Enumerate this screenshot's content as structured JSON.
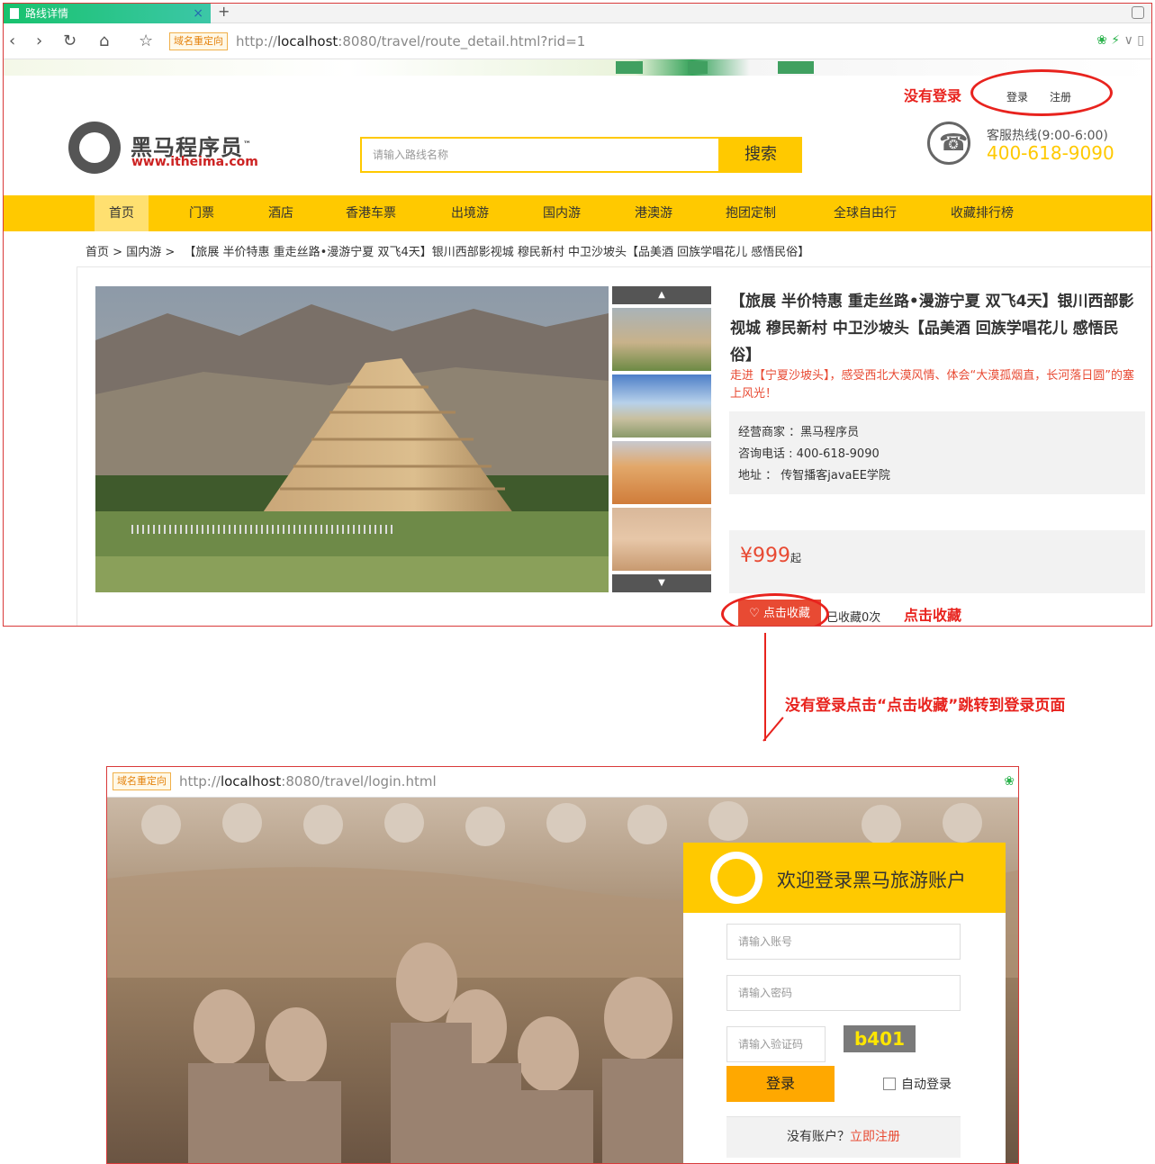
{
  "top_browser": {
    "tab_title": "路线详情",
    "tab_close": "×",
    "new_tab": "+",
    "redirect_badge": "域名重定向",
    "url_prefix": "http://",
    "url_host": "localhost",
    "url_rest": ":8080/travel/route_detail.html?rid=1"
  },
  "header": {
    "login_link": "登录",
    "register_link": "注册",
    "logo_title": "黑马程序员",
    "logo_tm": "™",
    "logo_url": "www.itheima.com",
    "search_placeholder": "请输入路线名称",
    "search_button": "搜索",
    "hotline_label": "客服热线(9:00-6:00)",
    "hotline_number": "400-618-9090"
  },
  "nav": [
    {
      "label": "首页",
      "active": true
    },
    {
      "label": "门票"
    },
    {
      "label": "酒店"
    },
    {
      "label": "香港车票"
    },
    {
      "label": "出境游"
    },
    {
      "label": "国内游"
    },
    {
      "label": "港澳游"
    },
    {
      "label": "抱团定制"
    },
    {
      "label": "全球自由行"
    },
    {
      "label": "收藏排行榜"
    }
  ],
  "breadcrumb": {
    "home": "首页",
    "sep1": " > ",
    "category": "国内游",
    "sep2": " > ",
    "current": "【旅展 半价特惠 重走丝路•漫游宁夏 双飞4天】银川西部影视城 穆民新村 中卫沙坡头【品美酒 回族学唱花儿 感悟民俗】"
  },
  "route": {
    "title": "【旅展 半价特惠 重走丝路•漫游宁夏 双飞4天】银川西部影视城 穆民新村 中卫沙坡头【品美酒 回族学唱花儿 感悟民俗】",
    "subtitle": "走进【宁夏沙坡头】，感受西北大漠风情、体会“大漠孤烟直，长河落日圆”的塞上风光！",
    "seller": "经营商家 ：黑马程序员",
    "phone": "咨询电话 : 400-618-9090",
    "address": "地址 ： 传智播客javaEE学院",
    "price": "¥999",
    "price_suffix": "起",
    "favorite_button": "点击收藏",
    "favorite_count": "已收藏0次",
    "thumb_up": "▲",
    "thumb_down": "▼"
  },
  "annotations": {
    "not_logged_in": "没有登录",
    "click_favorite": "点击收藏",
    "redirect_note": "没有登录点击“点击收藏”跳转到登录页面"
  },
  "bottom_browser": {
    "redirect_badge": "域名重定向",
    "url_prefix": "http://",
    "url_host": "localhost",
    "url_rest": ":8080/travel/login.html"
  },
  "login": {
    "title": "欢迎登录黑马旅游账户",
    "username_placeholder": "请输入账号",
    "password_placeholder": "请输入密码",
    "captcha_placeholder": "请输入验证码",
    "captcha_text": "b401",
    "login_button": "登录",
    "auto_login": "自动登录",
    "no_account": "没有账户？",
    "register_now": "立即注册"
  },
  "colors": {
    "accent_yellow": "#ffc900",
    "accent_red": "#e84a33",
    "annotation_red": "#e8231e"
  }
}
